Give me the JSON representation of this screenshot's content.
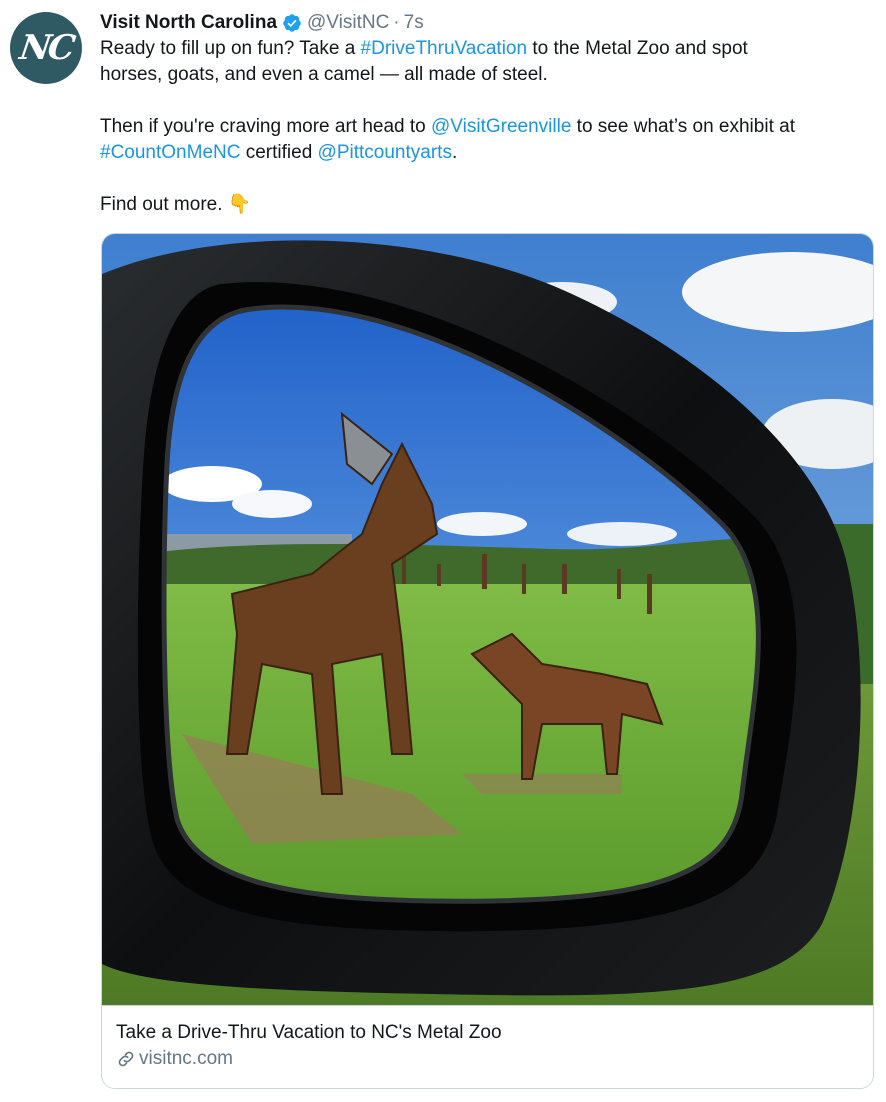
{
  "tweet": {
    "avatar_initials": "NC",
    "author_name": "Visit North Carolina",
    "handle": "@VisitNC",
    "separator": "·",
    "time": "7s",
    "line1_a": "Ready to fill up on fun? Take a ",
    "hashtag_drive": "#DriveThruVacation",
    "line1_b": " to the Metal Zoo and spot",
    "line2": "horses, goats, and even a camel — all made of steel.",
    "line3_a": "Then if you're craving more art head to ",
    "mention_greenville": "@VisitGreenville",
    "line3_b": " to see what’s on exhibit at",
    "hashtag_count": "#CountOnMeNC",
    "line4_a": " certified ",
    "mention_pitt": "@Pittcountyarts",
    "line4_b": ".",
    "line5": "Find out more. ",
    "emoji": "👇"
  },
  "card": {
    "title": "Take a Drive-Thru Vacation to NC's Metal Zoo",
    "domain": "visitnc.com"
  },
  "colors": {
    "link": "#1b95e0",
    "secondary": "#657786",
    "avatar_bg": "#2f5a63",
    "verified": "#1da1f2"
  }
}
